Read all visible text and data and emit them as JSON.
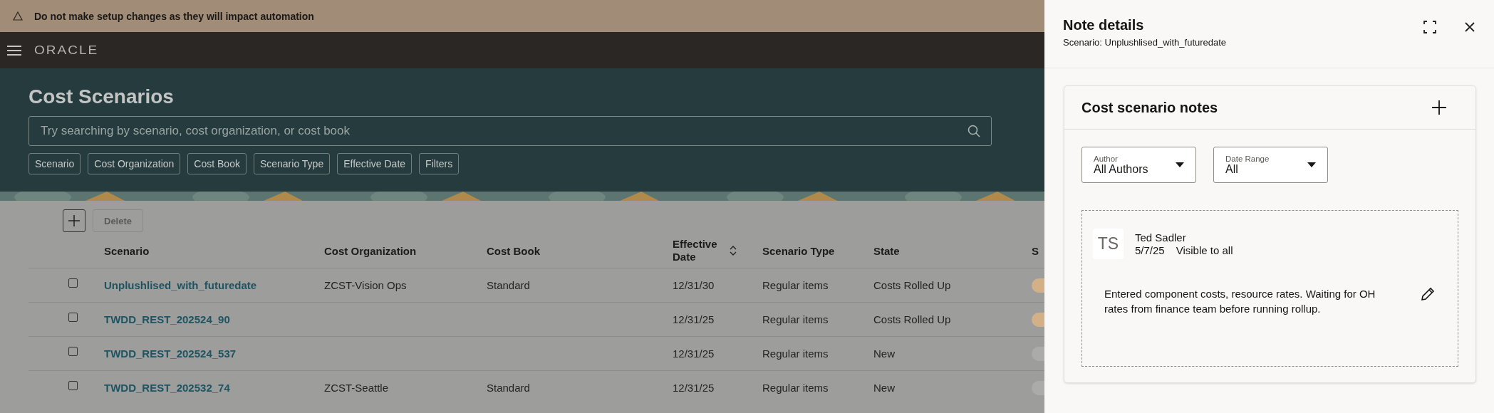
{
  "banner": {
    "text": "Do not make setup changes as they will impact automation"
  },
  "header": {
    "logo": "ORACLE"
  },
  "page": {
    "title": "Cost Scenarios",
    "search": {
      "placeholder": "Try searching by scenario, cost organization, or cost book"
    },
    "filter_chips": [
      "Scenario",
      "Cost Organization",
      "Cost Book",
      "Scenario Type",
      "Effective Date",
      "Filters"
    ]
  },
  "toolbar": {
    "delete_button": {
      "label": "Delete",
      "disabled": true
    }
  },
  "table": {
    "columns": [
      {
        "label": "Scenario",
        "sortable": false
      },
      {
        "label": "Cost Organization",
        "sortable": false
      },
      {
        "label": "Cost Book",
        "sortable": false
      },
      {
        "label": "Effective Date",
        "sortable": true
      },
      {
        "label": "Scenario Type",
        "sortable": false
      },
      {
        "label": "State",
        "sortable": false
      },
      {
        "label": "S",
        "sortable": false
      }
    ],
    "rows": [
      {
        "checked": false,
        "color": "#d3b088",
        "cells": [
          "Unplushlised_with_futuredate",
          "ZCST-Vision Ops",
          "Standard",
          "12/31/30",
          "Regular items",
          "Costs Rolled Up"
        ]
      },
      {
        "checked": false,
        "color": "#d3b088",
        "cells": [
          "TWDD_REST_202524_90",
          "",
          "",
          "12/31/25",
          "Regular items",
          "Costs Rolled Up"
        ]
      },
      {
        "checked": false,
        "color": "#ababa9",
        "cells": [
          "TWDD_REST_202524_537",
          "",
          "",
          "12/31/25",
          "Regular items",
          "New"
        ]
      },
      {
        "checked": false,
        "color": "#ababa9",
        "cells": [
          "TWDD_REST_202532_74",
          "ZCST-Seattle",
          "Standard",
          "12/31/25",
          "Regular items",
          "New"
        ]
      }
    ]
  },
  "panel": {
    "title": "Note details",
    "subtitle": "Scenario: Unplushlised_with_futuredate",
    "notes_card": {
      "title": "Cost scenario notes",
      "filters": [
        {
          "label": "Author",
          "value": "All Authors"
        },
        {
          "label": "Date Range",
          "value": "All"
        }
      ],
      "notes": [
        {
          "initials": "TS",
          "author": "Ted Sadler",
          "date": "5/7/25",
          "visibility": "Visible to all",
          "text": "Entered component costs, resource rates. Waiting for OH rates from finance team before running rollup."
        }
      ]
    }
  }
}
